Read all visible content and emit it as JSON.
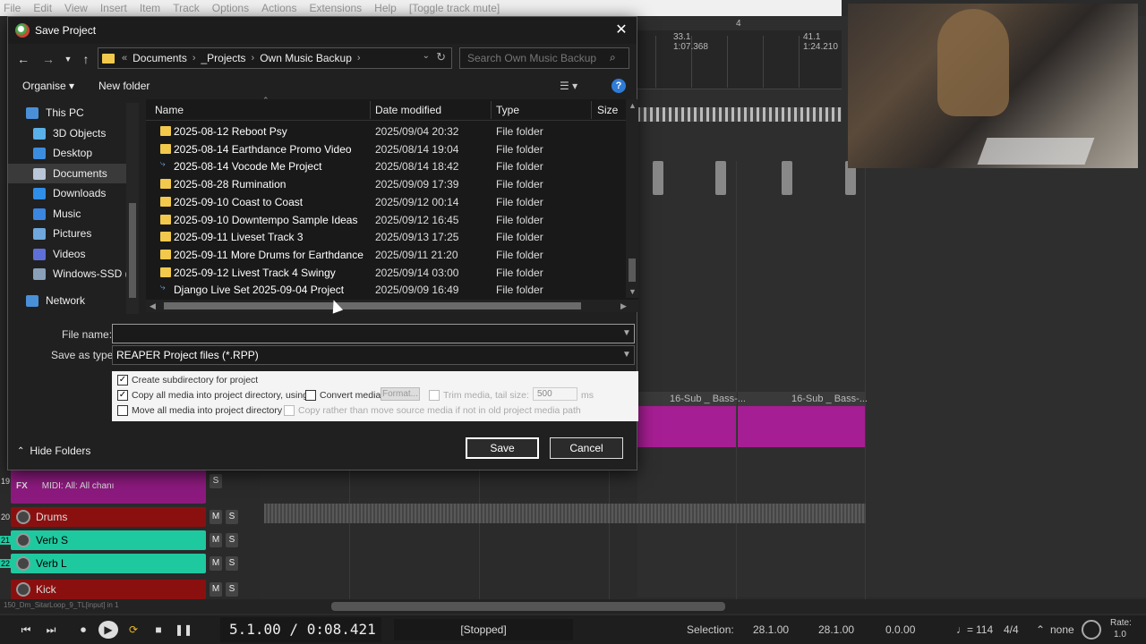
{
  "menubar": [
    "File",
    "Edit",
    "View",
    "Insert",
    "Item",
    "Track",
    "Options",
    "Actions",
    "Extensions",
    "Help",
    "[Toggle track mute]"
  ],
  "ruler": {
    "marker": "4",
    "labels": [
      {
        "pos": "33.1",
        "time": "1:07.368"
      },
      {
        "pos": "41.1",
        "time": "1:24.210"
      }
    ]
  },
  "midi_items": [
    "16-Sub _ Bass-...",
    "16-Sub _ Bass-..."
  ],
  "tracks": [
    {
      "num": "19",
      "name": "",
      "fx": "FX",
      "midi": "MIDI: All: All chanı",
      "color": "#8c1a7e"
    },
    {
      "num": "20",
      "name": "Drums",
      "color": "#8a1010"
    },
    {
      "num": "21",
      "name": "Verb S",
      "color": "#1fc9a0"
    },
    {
      "num": "22",
      "name": "Verb L",
      "color": "#1fc9a0"
    },
    {
      "num": "",
      "name": "Kick",
      "color": "#8a1010"
    }
  ],
  "transport": {
    "timecode": "5.1.00 / 0:08.421",
    "status": "[Stopped]",
    "selection_label": "Selection:",
    "sel_start": "28.1.00",
    "sel_end": "28.1.00",
    "sel_len": "0.0.00",
    "bpm": "114",
    "timesig": "4/4",
    "snap": "none",
    "rate_label": "Rate:",
    "rate": "1.0",
    "track_label": "150_Dm_SitarLoop_9_TL[input] in 1"
  },
  "dialog": {
    "title": "Save Project",
    "breadcrumb": [
      "Documents",
      "_Projects",
      "Own Music Backup"
    ],
    "search_placeholder": "Search Own Music Backup",
    "organise": "Organise",
    "new_folder": "New folder",
    "nav": [
      {
        "label": "This PC",
        "icon": "computer-icon",
        "color": "#4a90d9"
      },
      {
        "label": "3D Objects",
        "icon": "cube-icon",
        "color": "#5ab0e8"
      },
      {
        "label": "Desktop",
        "icon": "desktop-icon",
        "color": "#3c8de0"
      },
      {
        "label": "Documents",
        "icon": "document-icon",
        "color": "#b9c7d9"
      },
      {
        "label": "Downloads",
        "icon": "download-icon",
        "color": "#2f8ee8"
      },
      {
        "label": "Music",
        "icon": "music-icon",
        "color": "#3b86e0"
      },
      {
        "label": "Pictures",
        "icon": "pictures-icon",
        "color": "#6fa8dc"
      },
      {
        "label": "Videos",
        "icon": "video-icon",
        "color": "#5f6fd8"
      },
      {
        "label": "Windows-SSD (C",
        "icon": "drive-icon",
        "color": "#8aa0b8"
      },
      {
        "label": "Network",
        "icon": "network-icon",
        "color": "#4a90d9"
      }
    ],
    "columns": {
      "name": "Name",
      "date": "Date modified",
      "type": "Type",
      "size": "Size"
    },
    "files": [
      {
        "name": "2025-08-12 Reboot Psy",
        "date": "2025/09/04 20:32",
        "type": "File folder",
        "kind": "folder"
      },
      {
        "name": "2025-08-14 Earthdance Promo Video",
        "date": "2025/08/14 19:04",
        "type": "File folder",
        "kind": "folder"
      },
      {
        "name": "2025-08-14 Vocode Me Project",
        "date": "2025/08/14 18:42",
        "type": "File folder",
        "kind": "project"
      },
      {
        "name": "2025-08-28 Rumination",
        "date": "2025/09/09 17:39",
        "type": "File folder",
        "kind": "folder"
      },
      {
        "name": "2025-09-10 Coast to Coast",
        "date": "2025/09/12 00:14",
        "type": "File folder",
        "kind": "folder"
      },
      {
        "name": "2025-09-10 Downtempo Sample Ideas",
        "date": "2025/09/12 16:45",
        "type": "File folder",
        "kind": "folder"
      },
      {
        "name": "2025-09-11 Liveset Track 3",
        "date": "2025/09/13 17:25",
        "type": "File folder",
        "kind": "folder"
      },
      {
        "name": "2025-09-11 More Drums for Earthdance",
        "date": "2025/09/11 21:20",
        "type": "File folder",
        "kind": "folder"
      },
      {
        "name": "2025-09-12 Livest Track 4 Swingy",
        "date": "2025/09/14 03:00",
        "type": "File folder",
        "kind": "folder"
      },
      {
        "name": "Django Live Set 2025-09-04 Project",
        "date": "2025/09/09 16:49",
        "type": "File folder",
        "kind": "project"
      }
    ],
    "file_name_label": "File name:",
    "file_name_value": "",
    "save_type_label": "Save as type:",
    "save_type_value": "REAPER Project files (*.RPP)",
    "options": {
      "create_subdir": "Create subdirectory for project",
      "copy_media": "Copy all media into project directory, using:",
      "convert_media": "Convert media",
      "format": "Format...",
      "trim_media": "Trim media, tail size:",
      "tail_size": "500",
      "tail_unit": "ms",
      "move_media": "Move all media into project directory",
      "copy_rather": "Copy rather than move source media if not in old project media path"
    },
    "hide_folders": "Hide Folders",
    "save": "Save",
    "cancel": "Cancel"
  }
}
